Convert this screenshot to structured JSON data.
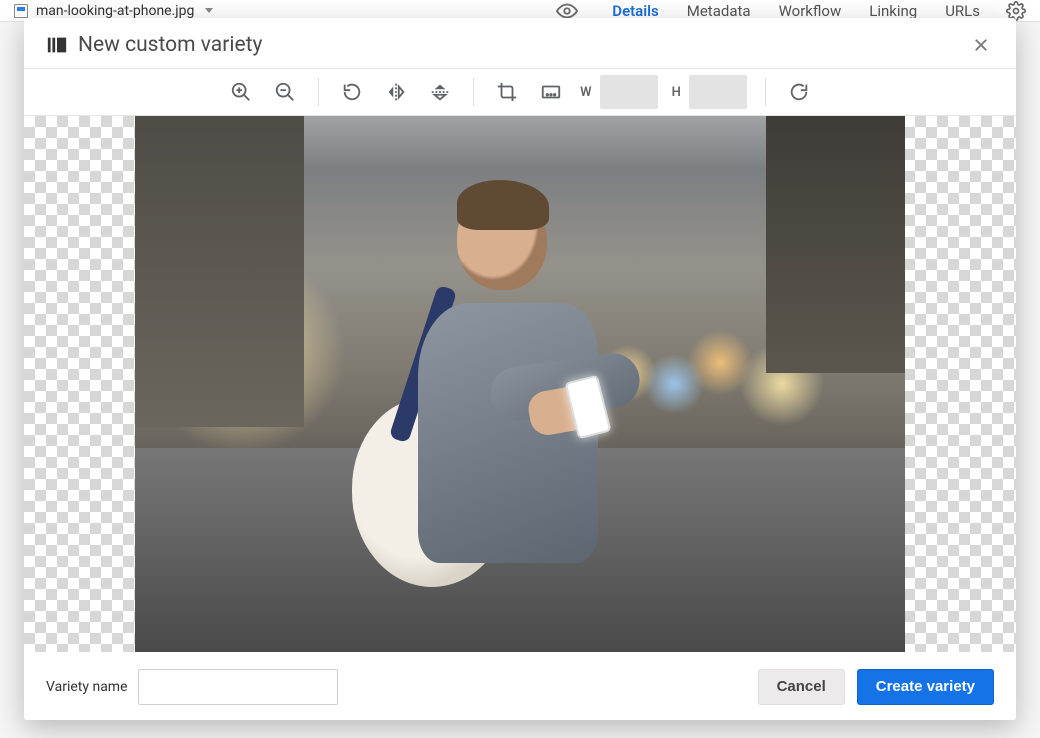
{
  "header": {
    "filename": "man-looking-at-phone.jpg",
    "tabs": [
      {
        "label": "Details",
        "active": true
      },
      {
        "label": "Metadata",
        "active": false
      },
      {
        "label": "Workflow",
        "active": false
      },
      {
        "label": "Linking",
        "active": false
      },
      {
        "label": "URLs",
        "active": false
      }
    ]
  },
  "dialog": {
    "title": "New custom variety",
    "dimensions": {
      "w_label": "W",
      "w_value": "",
      "h_label": "H",
      "h_value": ""
    },
    "footer": {
      "variety_name_label": "Variety name",
      "variety_name_value": "",
      "cancel_label": "Cancel",
      "create_label": "Create variety"
    }
  }
}
